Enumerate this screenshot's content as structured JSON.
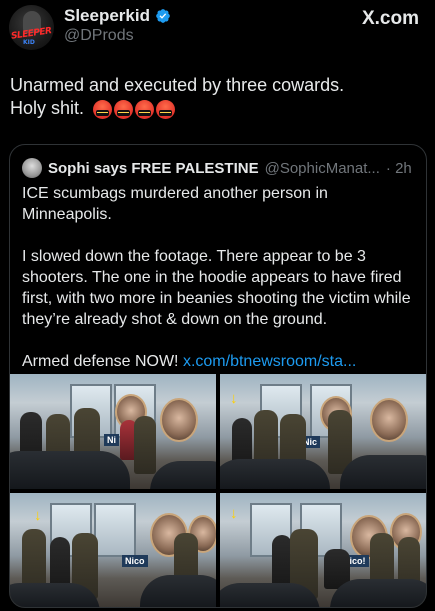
{
  "header": {
    "display_name": "Sleeperkid",
    "handle": "@DProds",
    "site": "X.com",
    "avatar_text": "SLEEPER",
    "avatar_subtext": "KID"
  },
  "tweet": {
    "line1": "Unarmed and executed by three cowards.",
    "line2": "Holy shit.",
    "emojis": [
      "face-with-symbols-on-mouth",
      "face-with-symbols-on-mouth",
      "face-with-symbols-on-mouth",
      "face-with-symbols-on-mouth"
    ]
  },
  "quote": {
    "name": "Sophi says FREE PALESTINE",
    "handle": "@SophicManat...",
    "time": "· 2h",
    "p1": "ICE scumbags murdered another person in Minneapolis.",
    "p2": "I slowed down the footage. There appear to be 3 shooters. The one in the hoodie appears to have fired first, with two more in beanies shooting the victim while they’re already shot & down on the ground.",
    "p3_text": "Armed defense NOW! ",
    "p3_link": "x.com/btnewsroom/sta...",
    "media_signs": [
      "Ni",
      "Nic",
      "Nico",
      "Nico!"
    ],
    "arrow_glyph": "↓"
  },
  "colors": {
    "background": "#000000",
    "text": "#e7e9ea",
    "secondary": "#71767b",
    "link": "#1d9bf0",
    "verified": "#1d9bf0",
    "border": "#2f3336"
  }
}
